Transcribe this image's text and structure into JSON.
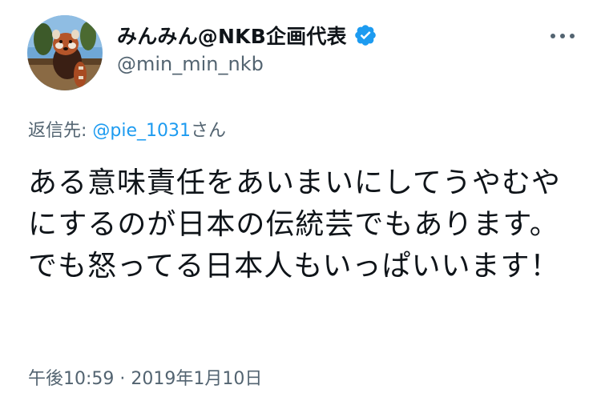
{
  "tweet": {
    "display_name": "みんみん@NKB企画代表",
    "handle": "@min_min_nkb",
    "reply_label": "返信先: ",
    "reply_mention": "@pie_1031",
    "reply_suffix": "さん",
    "body": "ある意味責任をあいまいにしてうやむやにするのが日本の伝統芸でもあります。でも怒ってる日本人もいっぱいいます！",
    "time": "午後10:59",
    "separator": " · ",
    "date": "2019年1月10日"
  },
  "icons": {
    "verified": "verified-badge-icon",
    "more": "more-options-icon"
  },
  "colors": {
    "accent": "#1d9bf0",
    "secondary_text": "#536471",
    "primary_text": "#0f1419"
  }
}
